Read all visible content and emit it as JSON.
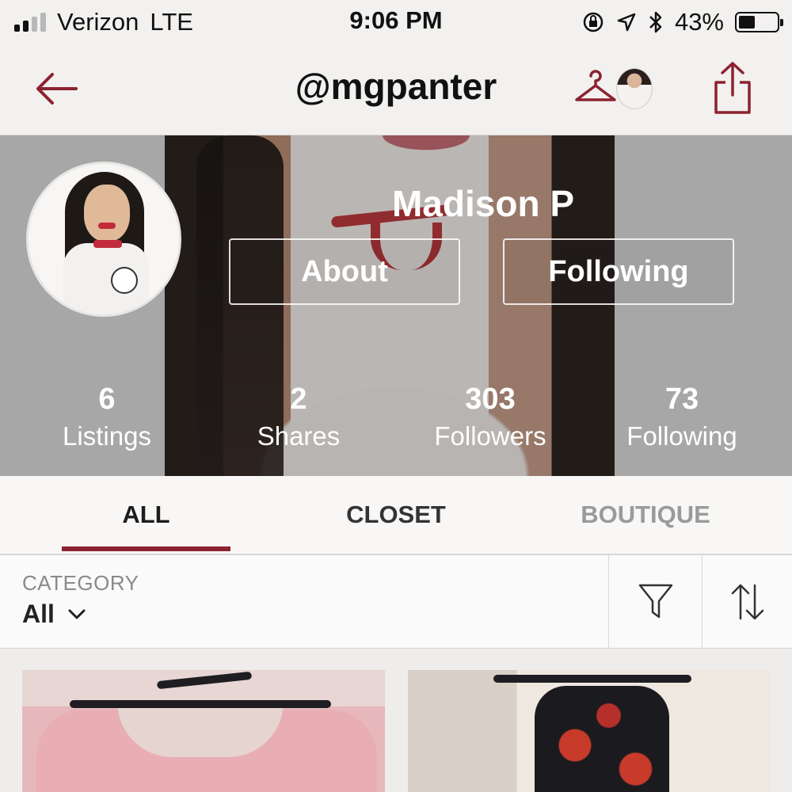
{
  "status_bar": {
    "carrier": "Verizon",
    "network": "LTE",
    "time": "9:06 PM",
    "battery_percent": "43%",
    "battery_level": 0.43
  },
  "nav": {
    "title": "@mgpanter"
  },
  "profile": {
    "name": "Madison P",
    "about_label": "About",
    "following_button_label": "Following",
    "stats": [
      {
        "value": "6",
        "label": "Listings"
      },
      {
        "value": "2",
        "label": "Shares"
      },
      {
        "value": "303",
        "label": "Followers"
      },
      {
        "value": "73",
        "label": "Following"
      }
    ]
  },
  "tabs": [
    {
      "label": "ALL",
      "active": true
    },
    {
      "label": "CLOSET",
      "active": false
    },
    {
      "label": "BOUTIQUE",
      "active": false
    }
  ],
  "filter": {
    "category_label": "CATEGORY",
    "category_value": "All"
  },
  "icons": {
    "back": "arrow-left-icon",
    "hanger": "hanger-icon",
    "share": "share-icon",
    "filter": "funnel-icon",
    "sort": "sort-arrows-icon",
    "dropdown": "chevron-down-icon"
  },
  "colors": {
    "accent": "#8c2230",
    "banner_bg": "#a7a7a7",
    "inactive_tab": "#9a9a9a"
  }
}
